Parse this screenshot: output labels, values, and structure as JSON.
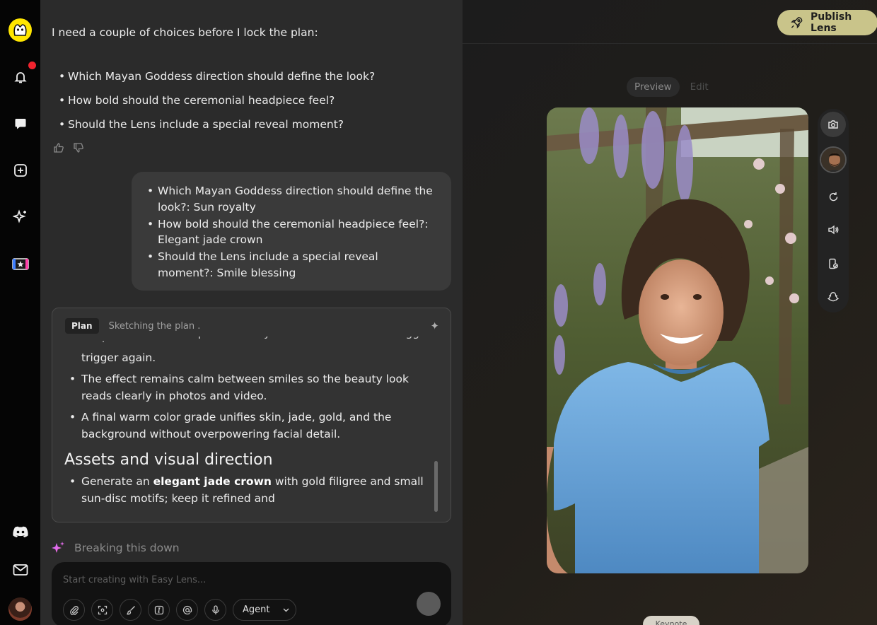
{
  "sidebar": {
    "items": [
      {
        "name": "logo",
        "icon": "easy-lens-logo-icon"
      },
      {
        "name": "notifications",
        "icon": "bell-icon",
        "has_badge": true
      },
      {
        "name": "messages",
        "icon": "chat-icon"
      },
      {
        "name": "create",
        "icon": "add-square-icon"
      },
      {
        "name": "ai",
        "icon": "sparkle-icon"
      },
      {
        "name": "lenses",
        "icon": "lens-gallery-icon"
      },
      {
        "name": "discord",
        "icon": "discord-icon"
      },
      {
        "name": "mail",
        "icon": "mail-icon"
      },
      {
        "name": "profile",
        "icon": "avatar"
      }
    ],
    "badge_color": "#f0232e"
  },
  "chat": {
    "assistant_intro": "I need a couple of choices before I lock the plan:",
    "assistant_questions": [
      "Which Mayan Goddess direction should define the look?",
      "How bold should the ceremonial headpiece feel?",
      "Should the Lens include a special reveal moment?"
    ],
    "user_answers": [
      "Which Mayan Goddess direction should define the look?: Sun royalty",
      "How bold should the ceremonial headpiece feel?: Elegant jade crown",
      "Should the Lens include a special reveal moment?: Smile blessing"
    ],
    "plan": {
      "tag": "Plan",
      "status": "Sketching the plan .",
      "cut_off_line": "Sun-disc reflections sparkle briefly before the crown can trigger again.",
      "continued_text": "trigger again.",
      "bullets": [
        "The effect remains calm between smiles so the beauty look reads clearly in photos and video.",
        "A final warm color grade unifies skin, jade, gold, and the background without overpowering facial detail."
      ],
      "section_heading": "Assets and visual direction",
      "asset_bullet": {
        "before": "Generate an ",
        "bold": "elegant jade crown",
        "after": " with gold filigree and small sun-disc motifs; keep it refined and"
      }
    },
    "thinking_text": "Breaking this down",
    "composer": {
      "placeholder": "Start creating with Easy Lens...",
      "mode": "Agent",
      "tools": [
        "attach-icon",
        "screenshot-icon",
        "brush-icon",
        "text-box-icon",
        "mention-icon",
        "microphone-icon"
      ]
    }
  },
  "preview_panel": {
    "publish_label": "Publish Lens",
    "tabs": [
      {
        "label": "Preview",
        "active": true
      },
      {
        "label": "Edit",
        "active": false
      }
    ],
    "tools": [
      "camera-icon",
      "model-avatar",
      "refresh-icon",
      "volume-icon",
      "device-icon",
      "snapchat-ghost-icon"
    ],
    "bottom_label": "Keynote",
    "accent": "#c9c48a"
  }
}
